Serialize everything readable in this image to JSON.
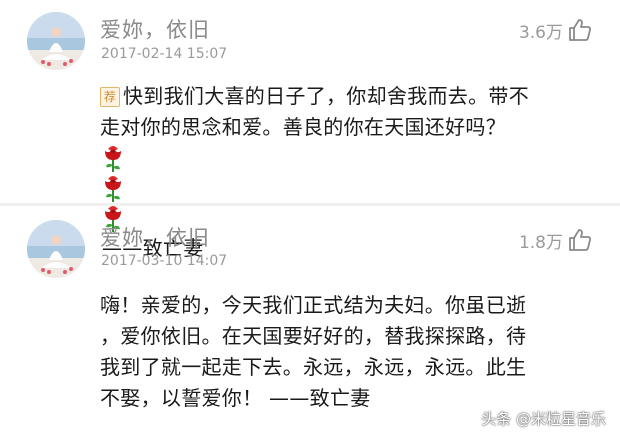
{
  "comments": [
    {
      "username": "爱妳，依旧",
      "timestamp": "2017-02-14 15:07",
      "likes": "3.6万",
      "badge": "荐",
      "content_lines": [
        "快到我们大喜的日子了，你却舍我而去。带不",
        "走对你的思念和爱。善良的你在天国还好吗？"
      ],
      "emoji": "rose-emoji",
      "emoji_count": 3,
      "signature": "——致亡妻"
    },
    {
      "username": "爱妳，依旧",
      "timestamp": "2017-03-10 14:07",
      "likes": "1.8万",
      "content_lines": [
        "嗨！亲爱的，今天我们正式结为夫妇。你虽已逝",
        "，爱你依旧。在天国要好好的，替我探探路，待",
        "我到了就一起走下去。永远，永远，永远。此生",
        "不娶，以誓爱你！ ——致亡妻"
      ]
    }
  ],
  "watermark": "头条 @米粒星音乐",
  "icons": {
    "like": "thumbs-up-icon",
    "avatar": "avatar-image"
  },
  "colors": {
    "username": "#8a8a8a",
    "meta": "#9a9a9a",
    "content": "#1a1a1a",
    "badge": "#d18a2c",
    "rose": "#d21a1a"
  }
}
